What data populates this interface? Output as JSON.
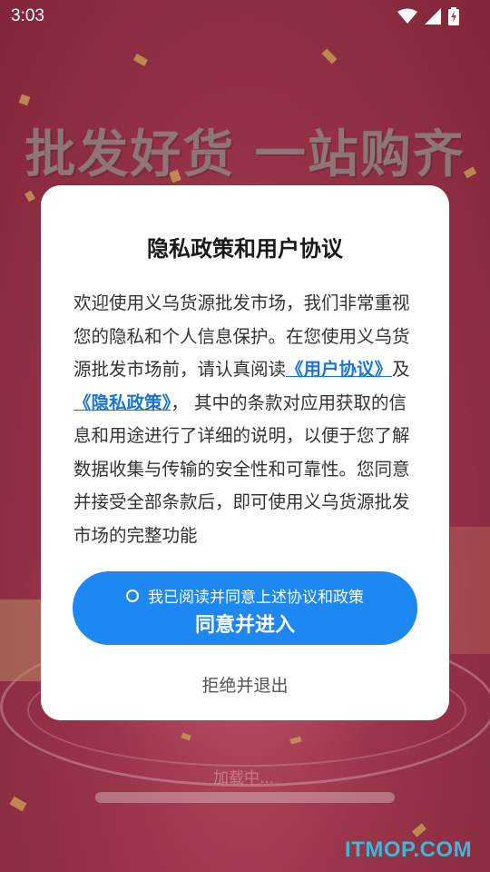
{
  "status_bar": {
    "time": "3:03",
    "icons": [
      "wifi-icon",
      "cell-signal-icon",
      "battery-charging-icon"
    ]
  },
  "background": {
    "headline": "批发好货 一站购齐",
    "loading_text": "加载中...",
    "watermark": "ITMOP.COM"
  },
  "dialog": {
    "title": "隐私政策和用户协议",
    "body_part1": "欢迎使用义乌货源批发市场，我们非常重视您的隐私和个人信息保护。在您使用义乌货源批发市场前，请认真阅读",
    "user_agreement_link": "《用户协议》",
    "conjunction": "及",
    "privacy_policy_link": "《隐私政策》",
    "body_part2": "， 其中的条款对应用获取的信息和用途进行了详细的说明，以便于您了解数据收集与传输的安全性和可靠性。您同意并接受全部条款后，即可使用义乌货源批发市场的完整功能",
    "checkbox_label": "我已阅读并同意上述协议和政策",
    "agree_button": "同意并进入",
    "reject_button": "拒绝并退出"
  },
  "colors": {
    "accent": "#1e88f2",
    "link": "#1976d2",
    "watermark": "#43c7e8"
  }
}
